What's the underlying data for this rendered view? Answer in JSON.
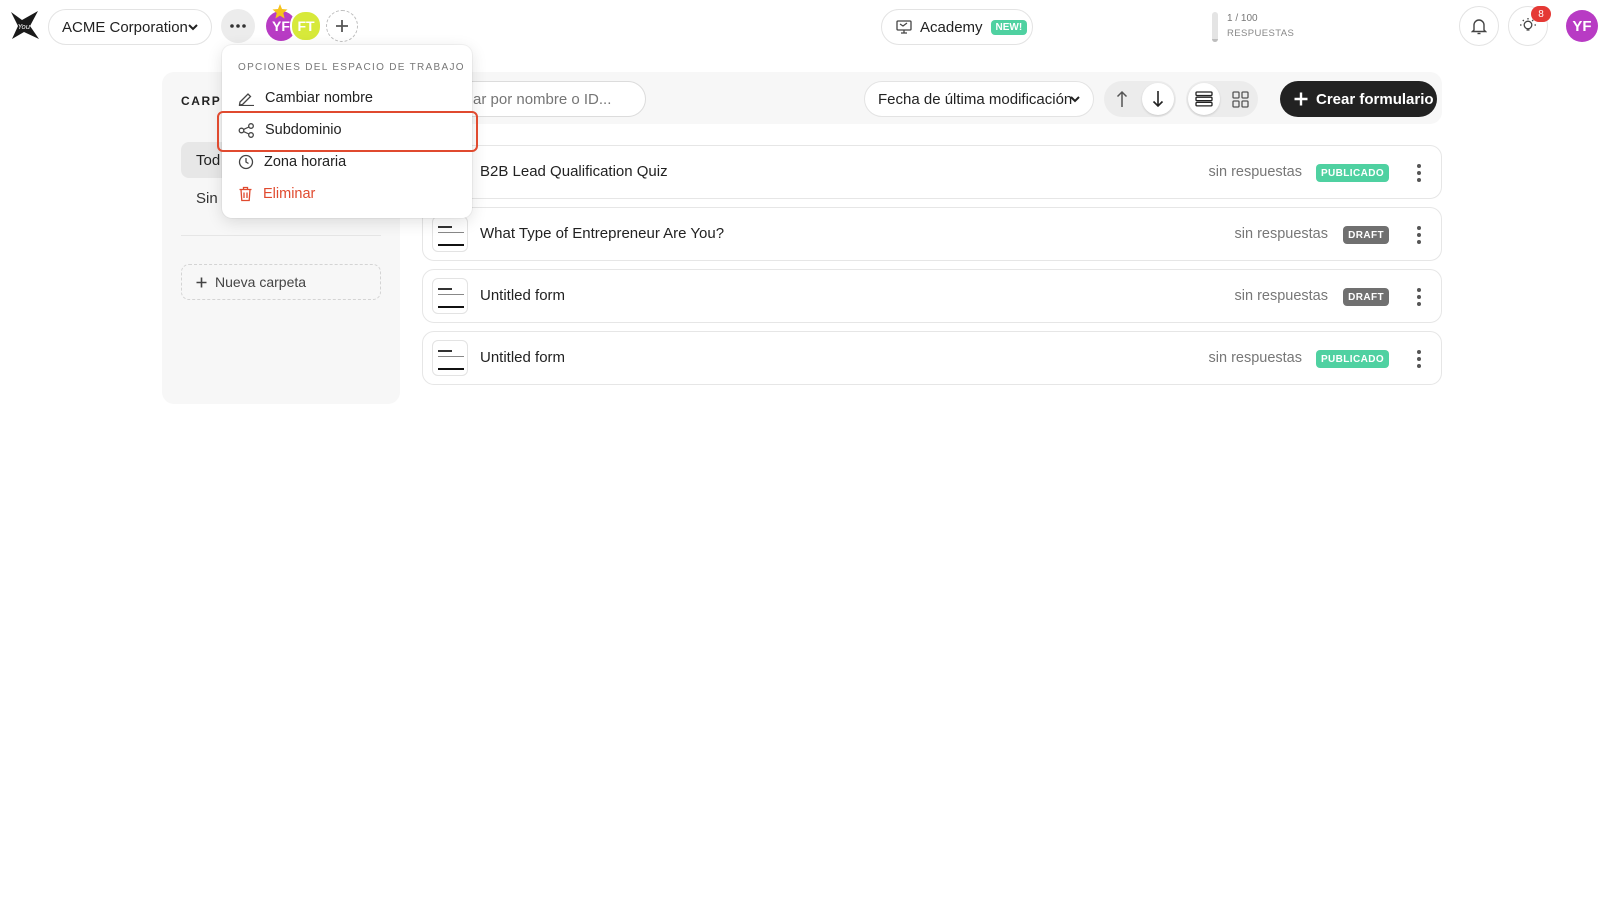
{
  "header": {
    "workspace_name": "ACME Corporation",
    "members": [
      "YF",
      "FT"
    ],
    "academy_label": "Academy",
    "academy_badge": "NEW!",
    "responses_count": "1 / 100",
    "responses_label": "RESPUESTAS",
    "responses_fraction": 0.01,
    "notification_count": "8",
    "user_initials": "YF"
  },
  "workspace_menu": {
    "header": "OPCIONES DEL ESPACIO DE TRABAJO",
    "items": [
      {
        "label": "Cambiar nombre",
        "icon": "pencil-icon"
      },
      {
        "label": "Subdominio",
        "icon": "share-icon"
      },
      {
        "label": "Zona horaria",
        "icon": "clock-icon"
      },
      {
        "label": "Eliminar",
        "icon": "trash-icon"
      }
    ]
  },
  "folders": {
    "title": "CARP",
    "all_label": "Tod",
    "none_label": "Sin",
    "new_folder_label": "Nueva carpeta"
  },
  "toolbar": {
    "search_placeholder": "ar por nombre o ID...",
    "sort_label": "Fecha de última modificación",
    "create_label": "Crear formulario"
  },
  "forms": [
    {
      "name": "B2B Lead Qualification Quiz",
      "responses": "sin respuestas",
      "status": "PUBLICADO"
    },
    {
      "name": "What Type of Entrepreneur Are You?",
      "responses": "sin respuestas",
      "status": "DRAFT"
    },
    {
      "name": "Untitled form",
      "responses": "sin respuestas",
      "status": "DRAFT"
    },
    {
      "name": "Untitled form",
      "responses": "sin respuestas",
      "status": "PUBLICADO"
    }
  ],
  "colors": {
    "accent_dark": "#222222",
    "published": "#4fd1a1",
    "draft": "#707070",
    "danger": "#e04a2f",
    "avatar_purple": "#b83bc4",
    "avatar_lime": "#d7e93a"
  }
}
